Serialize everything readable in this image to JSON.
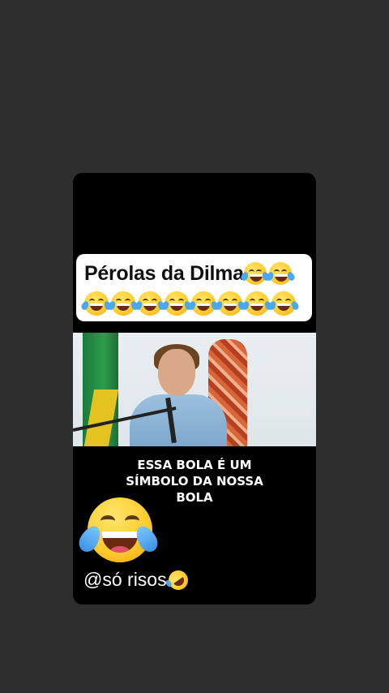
{
  "post": {
    "title": "Pérolas da Dilma",
    "title_emojis": [
      "face-with-tears-of-joy-icon",
      "face-with-tears-of-joy-icon"
    ],
    "emoji_row": [
      "face-with-tears-of-joy-icon",
      "face-with-tears-of-joy-icon",
      "face-with-tears-of-joy-icon",
      "face-with-tears-of-joy-icon",
      "face-with-tears-of-joy-icon",
      "face-with-tears-of-joy-icon",
      "face-with-tears-of-joy-icon",
      "face-with-tears-of-joy-icon"
    ],
    "caption_lines": [
      "ESSA BOLA É UM",
      "SÍMBOLO DA NOSSA",
      "BOLA"
    ],
    "big_emoji": "face-with-tears-of-joy-icon",
    "handle": "@só risos",
    "handle_emoji": "rolling-on-the-floor-laughing-icon"
  },
  "colors": {
    "page_background": "#2e2e2e",
    "card_background": "#000000",
    "title_box": "#ffffff",
    "caption_text": "#ffffff"
  }
}
